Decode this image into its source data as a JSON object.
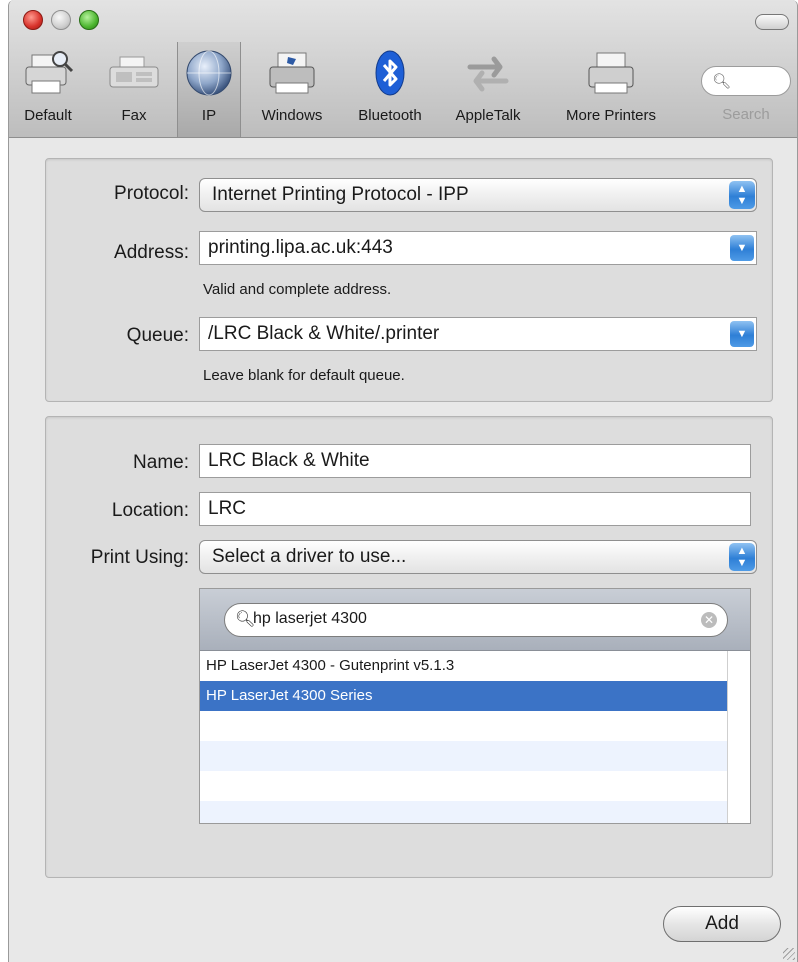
{
  "toolbar": {
    "items": [
      {
        "label": "Default",
        "icon": "default-printer-icon"
      },
      {
        "label": "Fax",
        "icon": "fax-icon"
      },
      {
        "label": "IP",
        "icon": "ip-globe-icon",
        "selected": true
      },
      {
        "label": "Windows",
        "icon": "windows-printer-icon"
      },
      {
        "label": "Bluetooth",
        "icon": "bluetooth-icon"
      },
      {
        "label": "AppleTalk",
        "icon": "appletalk-icon"
      },
      {
        "label": "More Printers",
        "icon": "more-printers-icon"
      }
    ],
    "search_label": "Search"
  },
  "ip_section": {
    "protocol_label": "Protocol:",
    "protocol_value": "Internet Printing Protocol - IPP",
    "address_label": "Address:",
    "address_value": "printing.lipa.ac.uk:443",
    "address_hint": "Valid and complete address.",
    "queue_label": "Queue:",
    "queue_value": "/LRC Black & White/.printer",
    "queue_hint": "Leave blank for default queue."
  },
  "printer_section": {
    "name_label": "Name:",
    "name_value": "LRC Black & White",
    "location_label": "Location:",
    "location_value": "LRC",
    "print_using_label": "Print Using:",
    "print_using_value": "Select a driver to use...",
    "driver_search_value": "hp laserjet 4300",
    "drivers": [
      "HP LaserJet 4300 - Gutenprint v5.1.3",
      "HP LaserJet 4300 Series"
    ],
    "selected_driver_index": 1
  },
  "footer": {
    "add_label": "Add"
  },
  "colors": {
    "accent_blue": "#3b73c6",
    "window_bg": "#e8e8e8",
    "close_red": "#d7312a",
    "max_green": "#4cb52f"
  }
}
